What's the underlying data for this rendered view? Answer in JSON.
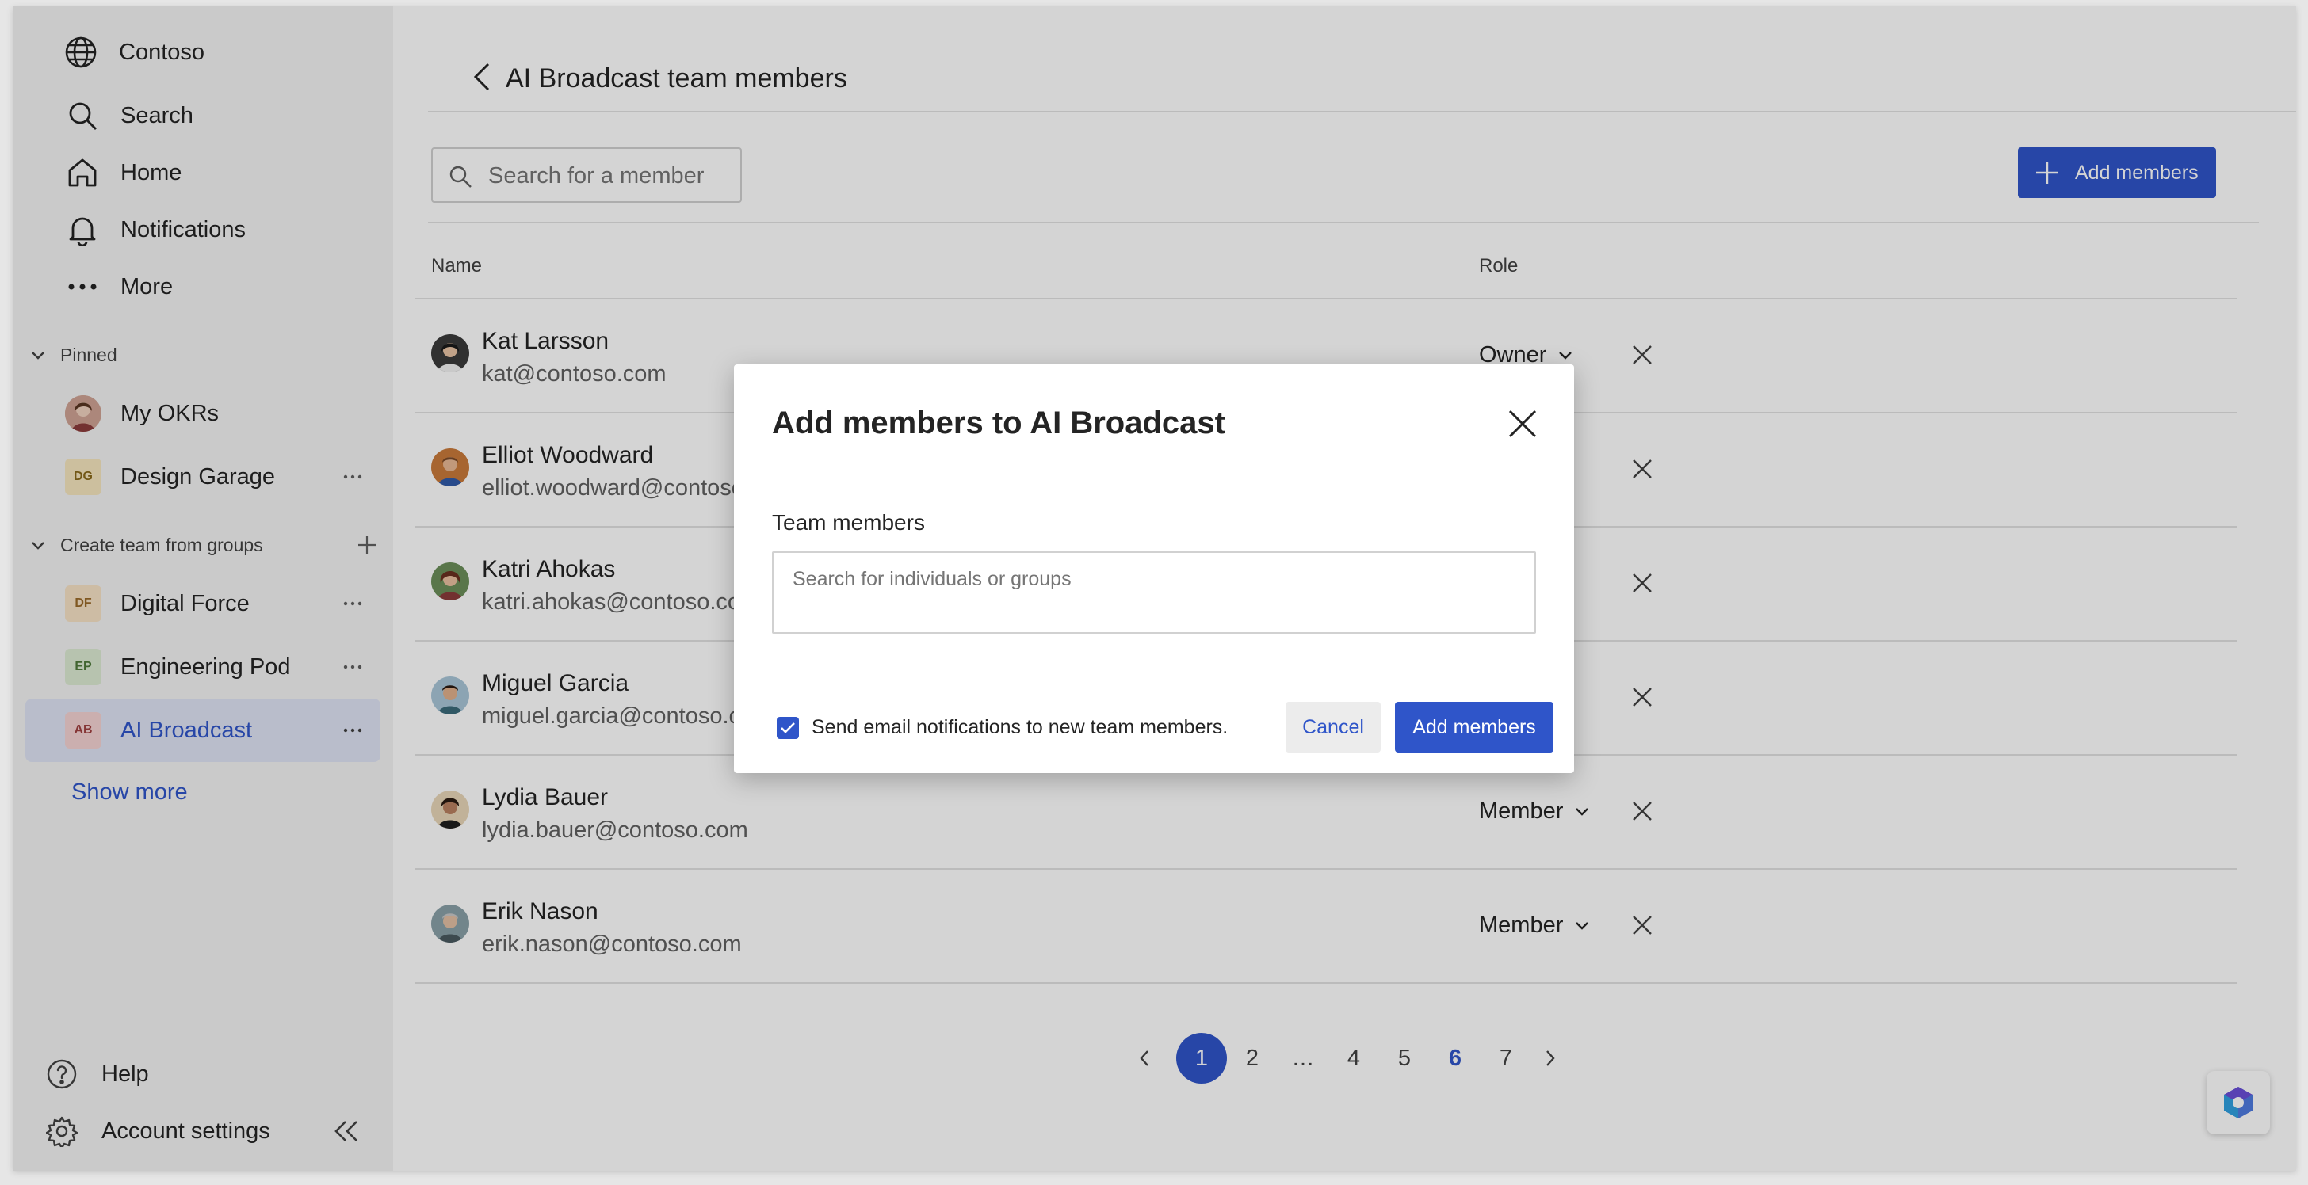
{
  "sidebar": {
    "org_name": "Contoso",
    "nav": [
      {
        "label": "Search",
        "icon": "search-icon"
      },
      {
        "label": "Home",
        "icon": "home-icon"
      },
      {
        "label": "Notifications",
        "icon": "bell-icon"
      },
      {
        "label": "More",
        "icon": "more-icon"
      }
    ],
    "pinned_header": "Pinned",
    "pinned": [
      {
        "label": "My OKRs",
        "initials": ""
      },
      {
        "label": "Design Garage",
        "initials": "DG"
      }
    ],
    "groups_header": "Create team from groups",
    "teams": [
      {
        "label": "Digital Force",
        "initials": "DF"
      },
      {
        "label": "Engineering Pod",
        "initials": "EP"
      },
      {
        "label": "AI Broadcast",
        "initials": "AB"
      }
    ],
    "show_more": "Show more",
    "help": "Help",
    "account_settings": "Account settings"
  },
  "main": {
    "title": "AI Broadcast team members",
    "search_placeholder": "Search for a member",
    "add_members_label": "Add members",
    "columns": {
      "name": "Name",
      "role": "Role"
    },
    "members": [
      {
        "name": "Kat Larsson",
        "email": "kat@contoso.com",
        "role": "Owner"
      },
      {
        "name": "Elliot Woodward",
        "email": "elliot.woodward@contoso.com",
        "role": ""
      },
      {
        "name": "Katri Ahokas",
        "email": "katri.ahokas@contoso.com",
        "role": ""
      },
      {
        "name": "Miguel Garcia",
        "email": "miguel.garcia@contoso.com",
        "role": ""
      },
      {
        "name": "Lydia Bauer",
        "email": "lydia.bauer@contoso.com",
        "role": "Member"
      },
      {
        "name": "Erik Nason",
        "email": "erik.nason@contoso.com",
        "role": "Member"
      }
    ],
    "pagination": {
      "pages": [
        "1",
        "2",
        "…",
        "4",
        "5",
        "6",
        "7"
      ],
      "current": "1",
      "highlighted": "6"
    }
  },
  "dialog": {
    "title": "Add members to AI Broadcast",
    "field_label": "Team members",
    "field_placeholder": "Search for individuals or groups",
    "checkbox_label": "Send email notifications to new team members.",
    "checkbox_checked": true,
    "cancel_label": "Cancel",
    "submit_label": "Add members"
  },
  "colors": {
    "accent": "#2f55c9",
    "sidebar_bg": "#f3f3f3",
    "selected_bg": "#dfe4f5",
    "overlay": "rgba(0,0,0,0.17)"
  }
}
